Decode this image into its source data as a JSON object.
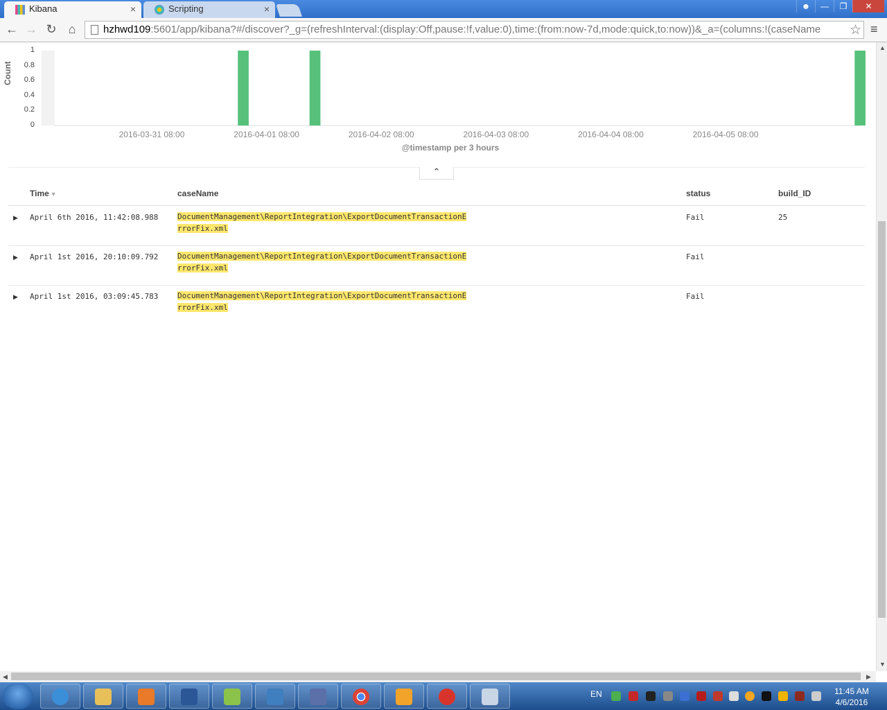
{
  "browser": {
    "tabs": [
      {
        "title": "Kibana",
        "active": true
      },
      {
        "title": "Scripting",
        "active": false
      }
    ],
    "close_glyph": "×",
    "url_host": "hzhwd109",
    "url_rest": ":5601/app/kibana?#/discover?_g=(refreshInterval:(display:Off,pause:!f,value:0),time:(from:now-7d,mode:quick,to:now))&_a=(columns:!(caseName"
  },
  "chart_data": {
    "type": "bar",
    "ylabel": "Count",
    "xlabel": "@timestamp per 3 hours",
    "ylim": [
      0,
      1
    ],
    "yticks": [
      "1",
      "0.8",
      "0.6",
      "0.4",
      "0.2",
      "0"
    ],
    "x_tick_labels": [
      "2016-03-31 08:00",
      "2016-04-01 08:00",
      "2016-04-02 08:00",
      "2016-04-03 08:00",
      "2016-04-04 08:00",
      "2016-04-05 08:00"
    ],
    "bars": [
      {
        "x": "2016-04-01 02:00",
        "value": 1
      },
      {
        "x": "2016-04-01 17:00",
        "value": 1
      },
      {
        "x": "2016-04-06 11:00",
        "value": 1
      }
    ],
    "bar_color": "#57c17b"
  },
  "table": {
    "columns": [
      "Time",
      "caseName",
      "status",
      "build_ID"
    ],
    "rows": [
      {
        "time": "April 6th 2016, 11:42:08.988",
        "case_line1": "DocumentManagement\\ReportIntegration\\ExportDocumentTransactionE",
        "case_line2": "rrorFix.xml",
        "status": "Fail",
        "build_id": "25"
      },
      {
        "time": "April 1st 2016, 20:10:09.792",
        "case_line1": "DocumentManagement\\ReportIntegration\\ExportDocumentTransactionE",
        "case_line2": "rrorFix.xml",
        "status": "Fail",
        "build_id": ""
      },
      {
        "time": "April 1st 2016, 03:09:45.783",
        "case_line1": "DocumentManagement\\ReportIntegration\\ExportDocumentTransactionE",
        "case_line2": "rrorFix.xml",
        "status": "Fail",
        "build_id": ""
      }
    ]
  },
  "taskbar": {
    "lang": "EN",
    "time": "11:45 AM",
    "date": "4/6/2016"
  }
}
